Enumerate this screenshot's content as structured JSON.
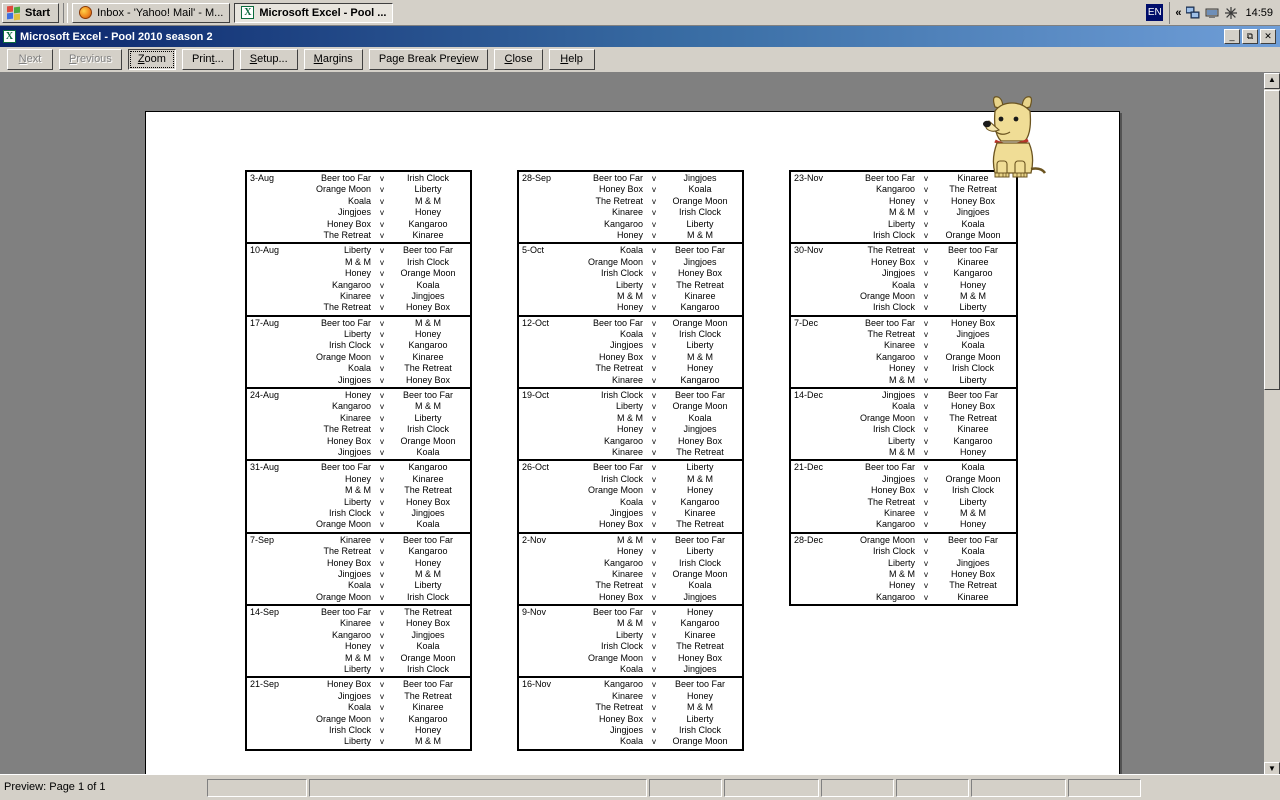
{
  "taskbar": {
    "start_label": "Start",
    "tasks": [
      {
        "label": "Inbox - 'Yahoo! Mail' - M...",
        "icon": "firefox-icon",
        "active": false
      },
      {
        "label": "Microsoft Excel - Pool ...",
        "icon": "excel-icon",
        "active": true
      }
    ],
    "language_indicator": "EN",
    "tray": {
      "expand_glyph": "«",
      "clock": "14:59"
    }
  },
  "window": {
    "title": "Microsoft Excel - Pool 2010 season 2",
    "icon": "excel-icon",
    "minimize_label": "_",
    "restore_label": "❐",
    "close_label": "×"
  },
  "preview_toolbar": {
    "buttons": [
      {
        "label": "Next",
        "accel": "N",
        "state": "disabled"
      },
      {
        "label": "Previous",
        "accel": "P",
        "state": "disabled"
      },
      {
        "label": "Zoom",
        "accel": "Z",
        "state": "focused"
      },
      {
        "label": "Print...",
        "accel": "t",
        "state": "normal"
      },
      {
        "label": "Setup...",
        "accel": "S",
        "state": "normal"
      },
      {
        "label": "Margins",
        "accel": "M",
        "state": "normal"
      },
      {
        "label": "Page Break Preview",
        "accel": "v",
        "state": "normal"
      },
      {
        "label": "Close",
        "accel": "C",
        "state": "normal"
      },
      {
        "label": "Help",
        "accel": "H",
        "state": "normal"
      }
    ]
  },
  "assistant": {
    "name": "office-assistant-dog",
    "character": "Rocky"
  },
  "statusbar": {
    "message": "Preview: Page 1 of 1",
    "panels": [
      "",
      "",
      "",
      "",
      "",
      "",
      ""
    ]
  },
  "scrollbars": {
    "vertical_up_glyph": "▲",
    "vertical_down_glyph": "▼"
  },
  "document": {
    "separator": "v",
    "columns": [
      {
        "weeks": [
          {
            "date": "3-Aug",
            "fixtures": [
              {
                "home": "Beer too Far",
                "away": "Irish Clock"
              },
              {
                "home": "Orange Moon",
                "away": "Liberty"
              },
              {
                "home": "Koala",
                "away": "M & M"
              },
              {
                "home": "Jingjoes",
                "away": "Honey"
              },
              {
                "home": "Honey Box",
                "away": "Kangaroo"
              },
              {
                "home": "The Retreat",
                "away": "Kinaree"
              }
            ]
          },
          {
            "date": "10-Aug",
            "fixtures": [
              {
                "home": "Liberty",
                "away": "Beer too Far"
              },
              {
                "home": "M & M",
                "away": "Irish Clock"
              },
              {
                "home": "Honey",
                "away": "Orange Moon"
              },
              {
                "home": "Kangaroo",
                "away": "Koala"
              },
              {
                "home": "Kinaree",
                "away": "Jingjoes"
              },
              {
                "home": "The Retreat",
                "away": "Honey Box"
              }
            ]
          },
          {
            "date": "17-Aug",
            "fixtures": [
              {
                "home": "Beer too Far",
                "away": "M & M"
              },
              {
                "home": "Liberty",
                "away": "Honey"
              },
              {
                "home": "Irish Clock",
                "away": "Kangaroo"
              },
              {
                "home": "Orange Moon",
                "away": "Kinaree"
              },
              {
                "home": "Koala",
                "away": "The Retreat"
              },
              {
                "home": "Jingjoes",
                "away": "Honey Box"
              }
            ]
          },
          {
            "date": "24-Aug",
            "fixtures": [
              {
                "home": "Honey",
                "away": "Beer too Far"
              },
              {
                "home": "Kangaroo",
                "away": "M & M"
              },
              {
                "home": "Kinaree",
                "away": "Liberty"
              },
              {
                "home": "The Retreat",
                "away": "Irish Clock"
              },
              {
                "home": "Honey Box",
                "away": "Orange Moon"
              },
              {
                "home": "Jingjoes",
                "away": "Koala"
              }
            ]
          },
          {
            "date": "31-Aug",
            "fixtures": [
              {
                "home": "Beer too Far",
                "away": "Kangaroo"
              },
              {
                "home": "Honey",
                "away": "Kinaree"
              },
              {
                "home": "M & M",
                "away": "The Retreat"
              },
              {
                "home": "Liberty",
                "away": "Honey Box"
              },
              {
                "home": "Irish Clock",
                "away": "Jingjoes"
              },
              {
                "home": "Orange Moon",
                "away": "Koala"
              }
            ]
          },
          {
            "date": "7-Sep",
            "fixtures": [
              {
                "home": "Kinaree",
                "away": "Beer too Far"
              },
              {
                "home": "The Retreat",
                "away": "Kangaroo"
              },
              {
                "home": "Honey Box",
                "away": "Honey"
              },
              {
                "home": "Jingjoes",
                "away": "M & M"
              },
              {
                "home": "Koala",
                "away": "Liberty"
              },
              {
                "home": "Orange Moon",
                "away": "Irish Clock"
              }
            ]
          },
          {
            "date": "14-Sep",
            "fixtures": [
              {
                "home": "Beer too Far",
                "away": "The Retreat"
              },
              {
                "home": "Kinaree",
                "away": "Honey Box"
              },
              {
                "home": "Kangaroo",
                "away": "Jingjoes"
              },
              {
                "home": "Honey",
                "away": "Koala"
              },
              {
                "home": "M & M",
                "away": "Orange Moon"
              },
              {
                "home": "Liberty",
                "away": "Irish Clock"
              }
            ]
          },
          {
            "date": "21-Sep",
            "fixtures": [
              {
                "home": "Honey Box",
                "away": "Beer too Far"
              },
              {
                "home": "Jingjoes",
                "away": "The Retreat"
              },
              {
                "home": "Koala",
                "away": "Kinaree"
              },
              {
                "home": "Orange Moon",
                "away": "Kangaroo"
              },
              {
                "home": "Irish Clock",
                "away": "Honey"
              },
              {
                "home": "Liberty",
                "away": "M & M"
              }
            ]
          }
        ]
      },
      {
        "weeks": [
          {
            "date": "28-Sep",
            "fixtures": [
              {
                "home": "Beer too Far",
                "away": "Jingjoes"
              },
              {
                "home": "Honey Box",
                "away": "Koala"
              },
              {
                "home": "The Retreat",
                "away": "Orange Moon"
              },
              {
                "home": "Kinaree",
                "away": "Irish Clock"
              },
              {
                "home": "Kangaroo",
                "away": "Liberty"
              },
              {
                "home": "Honey",
                "away": "M & M"
              }
            ]
          },
          {
            "date": "5-Oct",
            "fixtures": [
              {
                "home": "Koala",
                "away": "Beer too Far"
              },
              {
                "home": "Orange Moon",
                "away": "Jingjoes"
              },
              {
                "home": "Irish Clock",
                "away": "Honey Box"
              },
              {
                "home": "Liberty",
                "away": "The Retreat"
              },
              {
                "home": "M & M",
                "away": "Kinaree"
              },
              {
                "home": "Honey",
                "away": "Kangaroo"
              }
            ]
          },
          {
            "date": "12-Oct",
            "fixtures": [
              {
                "home": "Beer too Far",
                "away": "Orange Moon"
              },
              {
                "home": "Koala",
                "away": "Irish Clock"
              },
              {
                "home": "Jingjoes",
                "away": "Liberty"
              },
              {
                "home": "Honey Box",
                "away": "M & M"
              },
              {
                "home": "The Retreat",
                "away": "Honey"
              },
              {
                "home": "Kinaree",
                "away": "Kangaroo"
              }
            ]
          },
          {
            "date": "19-Oct",
            "fixtures": [
              {
                "home": "Irish Clock",
                "away": "Beer too Far"
              },
              {
                "home": "Liberty",
                "away": "Orange Moon"
              },
              {
                "home": "M & M",
                "away": "Koala"
              },
              {
                "home": "Honey",
                "away": "Jingjoes"
              },
              {
                "home": "Kangaroo",
                "away": "Honey Box"
              },
              {
                "home": "Kinaree",
                "away": "The Retreat"
              }
            ]
          },
          {
            "date": "26-Oct",
            "fixtures": [
              {
                "home": "Beer too Far",
                "away": "Liberty"
              },
              {
                "home": "Irish Clock",
                "away": "M & M"
              },
              {
                "home": "Orange Moon",
                "away": "Honey"
              },
              {
                "home": "Koala",
                "away": "Kangaroo"
              },
              {
                "home": "Jingjoes",
                "away": "Kinaree"
              },
              {
                "home": "Honey Box",
                "away": "The Retreat"
              }
            ]
          },
          {
            "date": "2-Nov",
            "fixtures": [
              {
                "home": "M & M",
                "away": "Beer too Far"
              },
              {
                "home": "Honey",
                "away": "Liberty"
              },
              {
                "home": "Kangaroo",
                "away": "Irish Clock"
              },
              {
                "home": "Kinaree",
                "away": "Orange Moon"
              },
              {
                "home": "The Retreat",
                "away": "Koala"
              },
              {
                "home": "Honey Box",
                "away": "Jingjoes"
              }
            ]
          },
          {
            "date": "9-Nov",
            "fixtures": [
              {
                "home": "Beer too Far",
                "away": "Honey"
              },
              {
                "home": "M & M",
                "away": "Kangaroo"
              },
              {
                "home": "Liberty",
                "away": "Kinaree"
              },
              {
                "home": "Irish Clock",
                "away": "The Retreat"
              },
              {
                "home": "Orange Moon",
                "away": "Honey Box"
              },
              {
                "home": "Koala",
                "away": "Jingjoes"
              }
            ]
          },
          {
            "date": "16-Nov",
            "fixtures": [
              {
                "home": "Kangaroo",
                "away": "Beer too Far"
              },
              {
                "home": "Kinaree",
                "away": "Honey"
              },
              {
                "home": "The Retreat",
                "away": "M & M"
              },
              {
                "home": "Honey Box",
                "away": "Liberty"
              },
              {
                "home": "Jingjoes",
                "away": "Irish Clock"
              },
              {
                "home": "Koala",
                "away": "Orange Moon"
              }
            ]
          }
        ]
      },
      {
        "weeks": [
          {
            "date": "23-Nov",
            "fixtures": [
              {
                "home": "Beer too Far",
                "away": "Kinaree"
              },
              {
                "home": "Kangaroo",
                "away": "The Retreat"
              },
              {
                "home": "Honey",
                "away": "Honey Box"
              },
              {
                "home": "M & M",
                "away": "Jingjoes"
              },
              {
                "home": "Liberty",
                "away": "Koala"
              },
              {
                "home": "Irish Clock",
                "away": "Orange Moon"
              }
            ]
          },
          {
            "date": "30-Nov",
            "fixtures": [
              {
                "home": "The Retreat",
                "away": "Beer too Far"
              },
              {
                "home": "Honey Box",
                "away": "Kinaree"
              },
              {
                "home": "Jingjoes",
                "away": "Kangaroo"
              },
              {
                "home": "Koala",
                "away": "Honey"
              },
              {
                "home": "Orange Moon",
                "away": "M & M"
              },
              {
                "home": "Irish Clock",
                "away": "Liberty"
              }
            ]
          },
          {
            "date": "7-Dec",
            "fixtures": [
              {
                "home": "Beer too Far",
                "away": "Honey Box"
              },
              {
                "home": "The Retreat",
                "away": "Jingjoes"
              },
              {
                "home": "Kinaree",
                "away": "Koala"
              },
              {
                "home": "Kangaroo",
                "away": "Orange Moon"
              },
              {
                "home": "Honey",
                "away": "Irish Clock"
              },
              {
                "home": "M & M",
                "away": "Liberty"
              }
            ]
          },
          {
            "date": "14-Dec",
            "fixtures": [
              {
                "home": "Jingjoes",
                "away": "Beer too Far"
              },
              {
                "home": "Koala",
                "away": "Honey Box"
              },
              {
                "home": "Orange Moon",
                "away": "The Retreat"
              },
              {
                "home": "Irish Clock",
                "away": "Kinaree"
              },
              {
                "home": "Liberty",
                "away": "Kangaroo"
              },
              {
                "home": "M & M",
                "away": "Honey"
              }
            ]
          },
          {
            "date": "21-Dec",
            "fixtures": [
              {
                "home": "Beer too Far",
                "away": "Koala"
              },
              {
                "home": "Jingjoes",
                "away": "Orange Moon"
              },
              {
                "home": "Honey Box",
                "away": "Irish Clock"
              },
              {
                "home": "The Retreat",
                "away": "Liberty"
              },
              {
                "home": "Kinaree",
                "away": "M & M"
              },
              {
                "home": "Kangaroo",
                "away": "Honey"
              }
            ]
          },
          {
            "date": "28-Dec",
            "fixtures": [
              {
                "home": "Orange Moon",
                "away": "Beer too Far"
              },
              {
                "home": "Irish Clock",
                "away": "Koala"
              },
              {
                "home": "Liberty",
                "away": "Jingjoes"
              },
              {
                "home": "M & M",
                "away": "Honey Box"
              },
              {
                "home": "Honey",
                "away": "The Retreat"
              },
              {
                "home": "Kangaroo",
                "away": "Kinaree"
              }
            ]
          }
        ]
      }
    ]
  }
}
